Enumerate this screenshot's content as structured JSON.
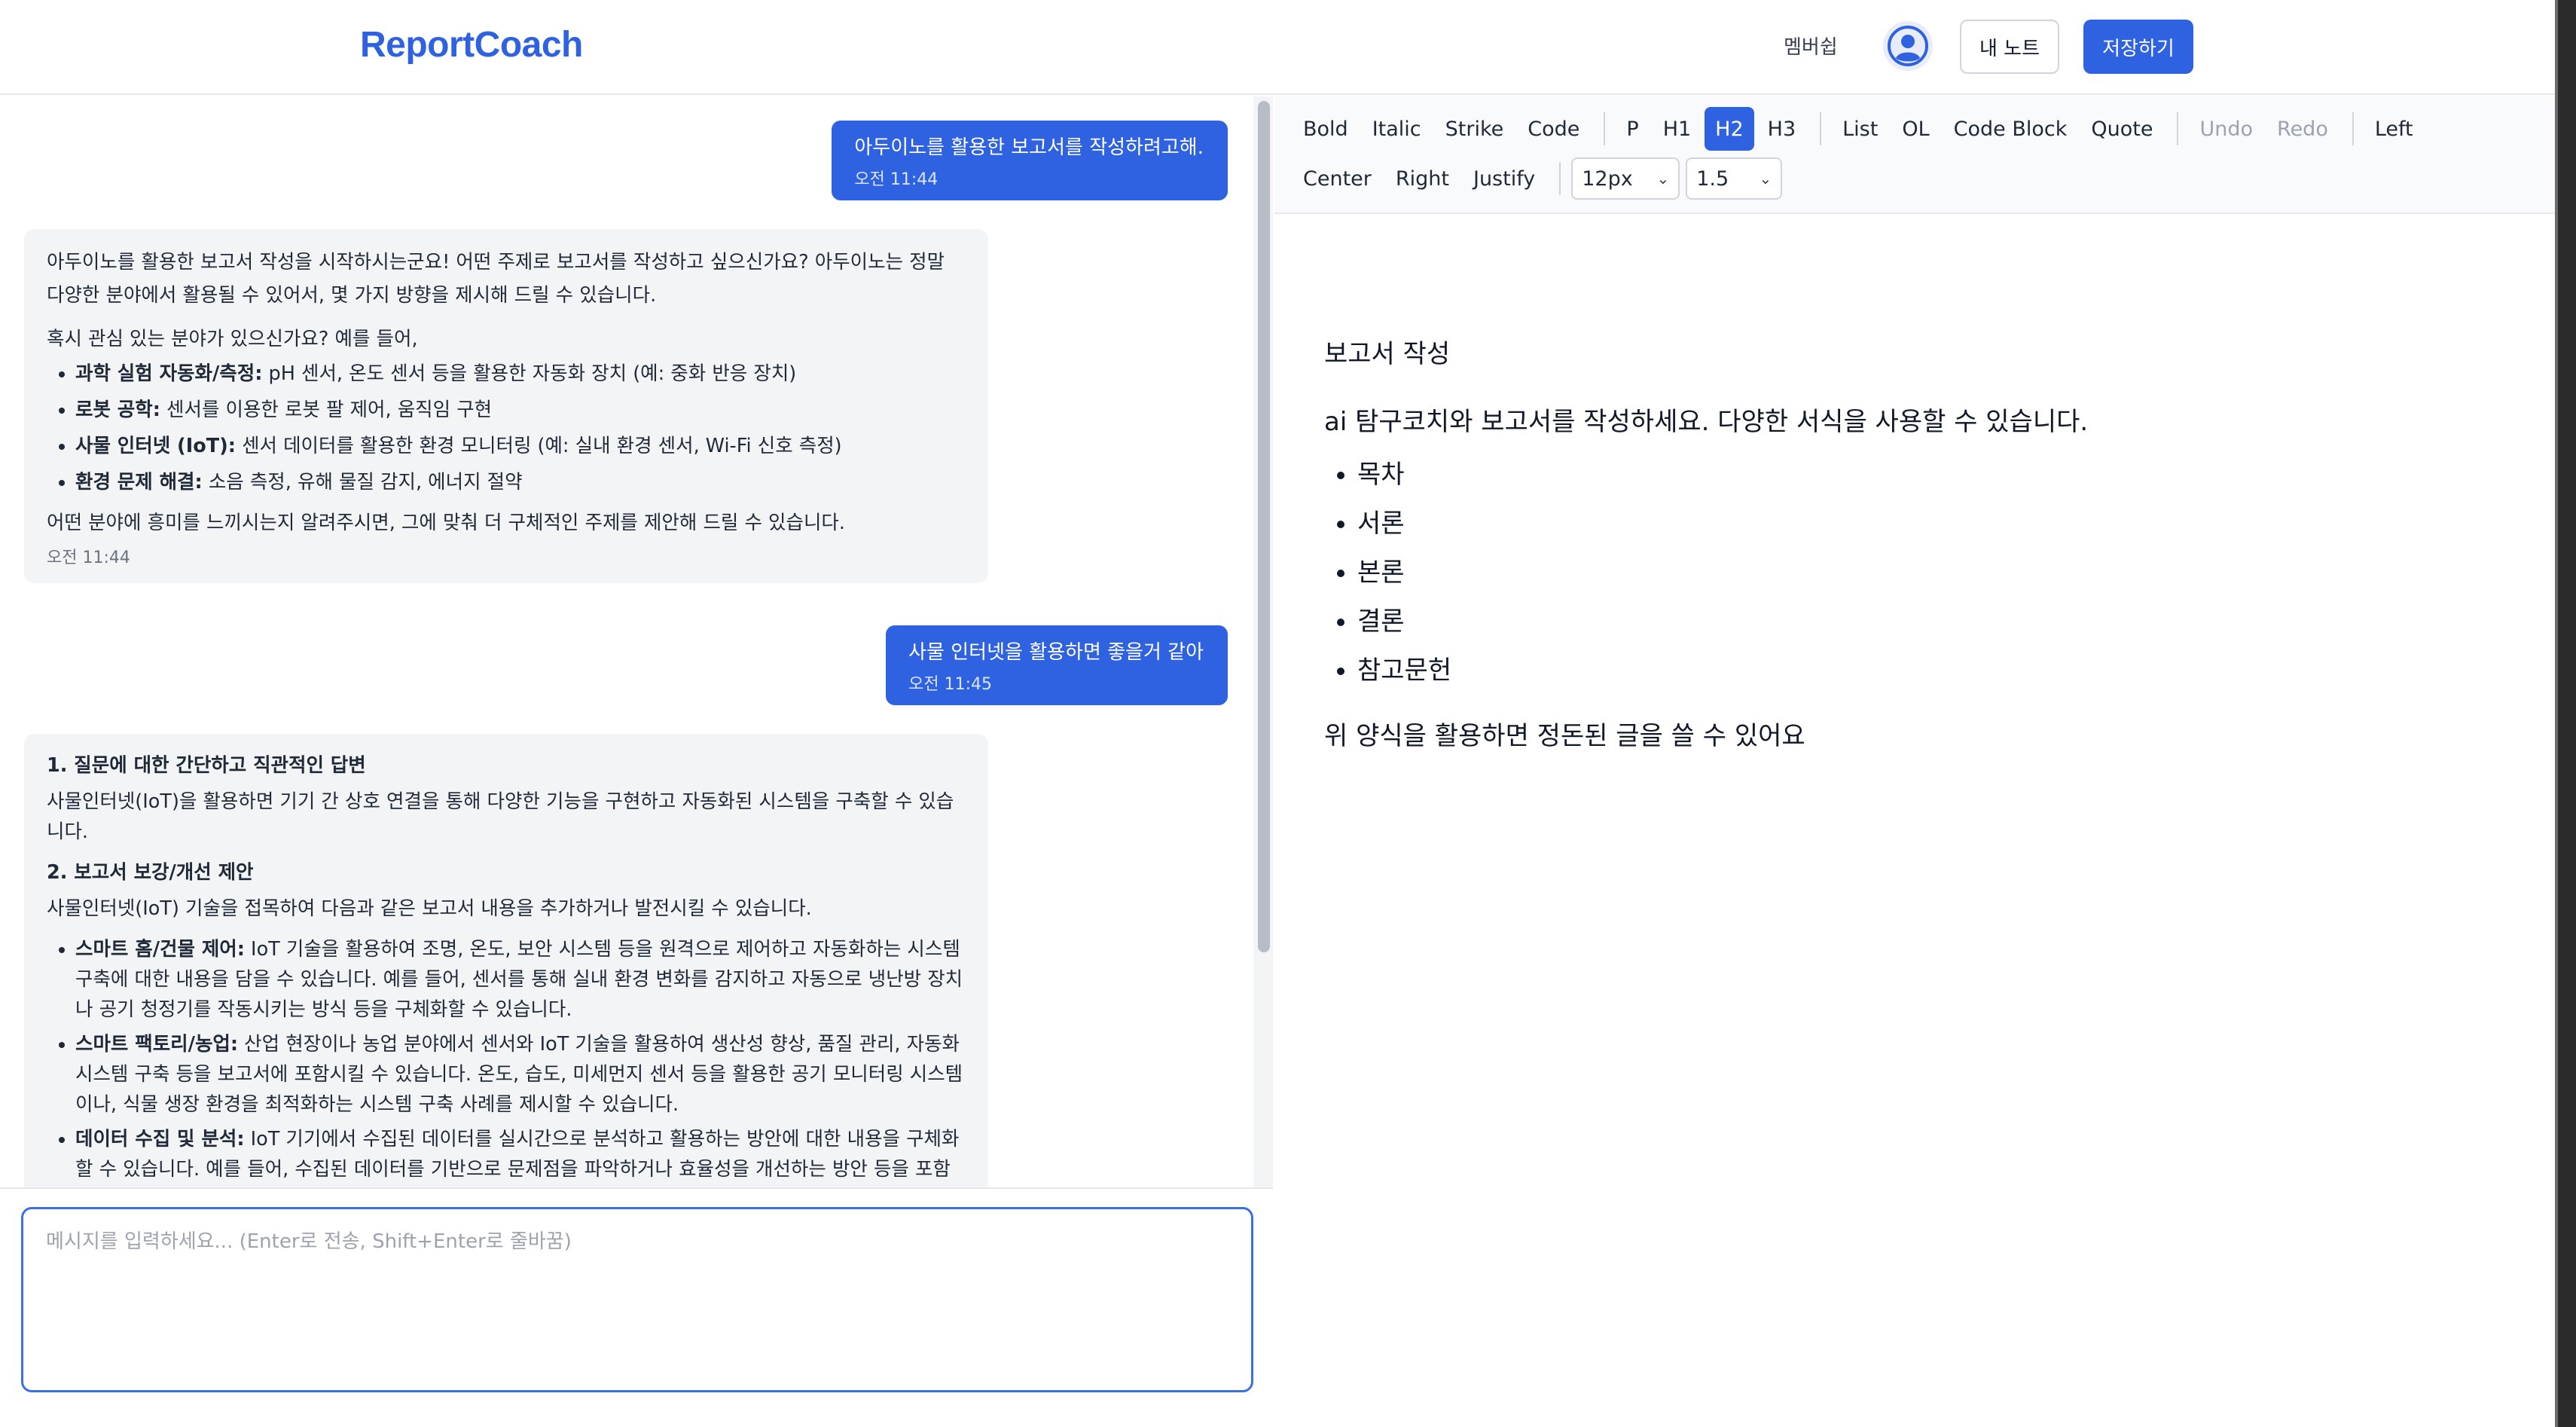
{
  "header": {
    "logo": "ReportCoach",
    "membership_label": "멤버쉽",
    "notes_button": "내 노트",
    "save_button": "저장하기"
  },
  "chat": {
    "messages": [
      {
        "role": "user",
        "text": "아두이노를 활용한 보고서를 작성하려고해.",
        "time": "오전 11:44"
      },
      {
        "role": "assistant",
        "intro": "아두이노를 활용한 보고서 작성을 시작하시는군요! 어떤 주제로 보고서를 작성하고 싶으신가요? 아두이노는 정말 다양한 분야에서 활용될 수 있어서, 몇 가지 방향을 제시해 드릴 수 있습니다.",
        "question": "혹시 관심 있는 분야가 있으신가요? 예를 들어,",
        "items": [
          {
            "label": "과학 실험 자동화/측정:",
            "text": " pH 센서, 온도 센서 등을 활용한 자동화 장치 (예: 중화 반응 장치)"
          },
          {
            "label": "로봇 공학:",
            "text": " 센서를 이용한 로봇 팔 제어, 움직임 구현"
          },
          {
            "label": "사물 인터넷 (IoT):",
            "text": " 센서 데이터를 활용한 환경 모니터링 (예: 실내 환경 센서, Wi-Fi 신호 측정)"
          },
          {
            "label": "환경 문제 해결:",
            "text": " 소음 측정, 유해 물질 감지, 에너지 절약"
          }
        ],
        "closing": "어떤 분야에 흥미를 느끼시는지 알려주시면, 그에 맞춰 더 구체적인 주제를 제안해 드릴 수 있습니다.",
        "time": "오전 11:44"
      },
      {
        "role": "user",
        "text": "사물 인터넷을 활용하면 좋을거 같아",
        "time": "오전 11:45"
      },
      {
        "role": "assistant",
        "heading1": "1. 질문에 대한 간단하고 직관적인 답변",
        "answer": "사물인터넷(IoT)을 활용하면 기기 간 상호 연결을 통해 다양한 기능을 구현하고 자동화된 시스템을 구축할 수 있습니다.",
        "heading2": "2. 보고서 보강/개선 제안",
        "intro2": "사물인터넷(IoT) 기술을 접목하여 다음과 같은 보고서 내용을 추가하거나 발전시킬 수 있습니다.",
        "items": [
          {
            "label": "스마트 홈/건물 제어:",
            "text": " IoT 기술을 활용하여 조명, 온도, 보안 시스템 등을 원격으로 제어하고 자동화하는 시스템 구축에 대한 내용을 담을 수 있습니다. 예를 들어, 센서를 통해 실내 환경 변화를 감지하고 자동으로 냉난방 장치나 공기 청정기를 작동시키는 방식 등을 구체화할 수 있습니다."
          },
          {
            "label": "스마트 팩토리/농업:",
            "text": " 산업 현장이나 농업 분야에서 센서와 IoT 기술을 활용하여 생산성 향상, 품질 관리, 자동화 시스템 구축 등을 보고서에 포함시킬 수 있습니다. 온도, 습도, 미세먼지 센서 등을 활용한 공기 모니터링 시스템이나, 식물 생장 환경을 최적화하는 시스템 구축 사례를 제시할 수 있습니다."
          },
          {
            "label": "데이터 수집 및 분석:",
            "text": " IoT 기기에서 수집된 데이터를 실시간으로 분석하고 활용하는 방안에 대한 내용을 구체화할 수 있습니다. 예를 들어, 수집된 데이터를 기반으로 문제점을 파악하거나 효율성을 개선하는 방안 등을 포함"
          }
        ]
      }
    ],
    "input_placeholder": "메시지를 입력하세요... (Enter로 전송, Shift+Enter로 줄바꿈)"
  },
  "toolbar": {
    "row1": {
      "format": [
        "Bold",
        "Italic",
        "Strike",
        "Code"
      ],
      "blocks": [
        "P",
        "H1",
        "H2",
        "H3"
      ],
      "active_block": "H2",
      "lists": [
        "List",
        "OL",
        "Code Block",
        "Quote"
      ],
      "history": [
        "Undo",
        "Redo"
      ],
      "align_first": "Left"
    },
    "row2": {
      "align": [
        "Center",
        "Right",
        "Justify"
      ],
      "font_size": "12px",
      "line_height": "1.5"
    }
  },
  "document": {
    "title": "보고서 작성",
    "intro": "ai 탐구코치와 보고서를 작성하세요. 다양한 서식을 사용할 수 있습니다.",
    "items": [
      "목차",
      "서론",
      "본론",
      "결론",
      "참고문헌"
    ],
    "closing": "위 양식을 활용하면 정돈된 글을 쓸 수 있어요"
  },
  "colors": {
    "primary": "#2f62e0",
    "bubble_ai_bg": "#f3f4f6"
  }
}
